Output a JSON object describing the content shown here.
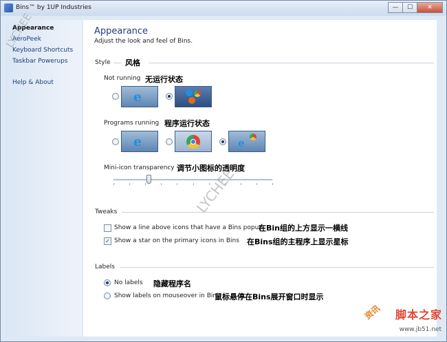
{
  "window": {
    "title": "Bins™ by 1UP Industries"
  },
  "sidebar": {
    "items": [
      {
        "label": "Appearance",
        "active": true
      },
      {
        "label": "AeroPeek"
      },
      {
        "label": "Keyboard Shortcuts"
      },
      {
        "label": "Taskbar Powerups"
      },
      {
        "label": "Help & About"
      }
    ]
  },
  "main": {
    "heading": "Appearance",
    "subtitle": "Adjust the look and feel of Bins.",
    "style": {
      "section_label": "Style",
      "section_cn": "风格",
      "not_running_label": "Not running",
      "not_running_cn": "无运行状态",
      "not_running_selected": 1,
      "programs_running_label": "Programs running",
      "programs_running_cn": "程序运行状态",
      "programs_running_selected": 2,
      "mini_icon_label": "Mini-icon transparency",
      "mini_icon_cn": "调节小图标的透明度",
      "mini_icon_transparency": 0.22
    },
    "tweaks": {
      "section_label": "Tweaks",
      "line_above_label": "Show a line above icons that have a Bins popup",
      "line_above_cn": "在Bin组的上方显示一横线",
      "line_above_checked": false,
      "star_label": "Show a star on the primary icons in Bins",
      "star_cn": "在Bins组的主程序上显示星标",
      "star_checked": true
    },
    "labels": {
      "section_label": "Labels",
      "no_labels_label": "No labels",
      "no_labels_cn": "隐藏程序名",
      "mouseover_label": "Show labels on mouseover in Bins",
      "mouseover_cn": "鼠标悬停在Bins展开窗口时显示",
      "selected": "no_labels"
    }
  },
  "watermarks": {
    "left": "LYCHEE",
    "center": "LYCHEE",
    "bottom_right": "脚本之家",
    "bottom_right_url": "www.jb51.net",
    "edge": "资讯"
  },
  "colors": {
    "accent": "#1f3f77",
    "ie_blue": "#1f8fe0"
  }
}
